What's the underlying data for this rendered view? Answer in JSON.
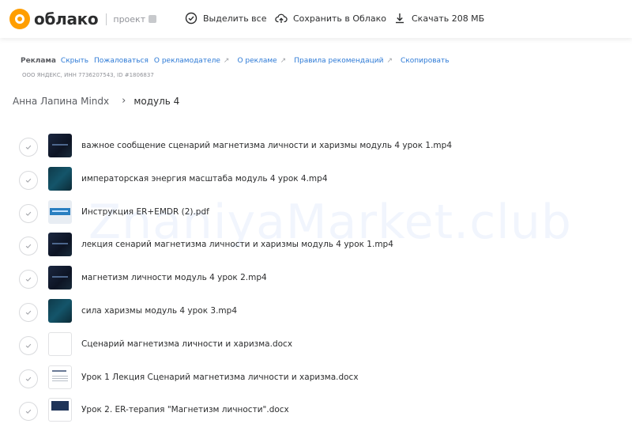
{
  "header": {
    "logo_text": "облако",
    "logo_sub": "проект",
    "select_all": "Выделить все",
    "save_to_cloud": "Сохранить в Облако",
    "download": "Скачать 208 МБ"
  },
  "ad": {
    "label": "Реклама",
    "hide": "Скрыть",
    "complain": "Пожаловаться",
    "about_advertiser": "О рекламодателе",
    "about_ad": "О рекламе",
    "rules": "Правила рекомендаций",
    "copy": "Скопировать",
    "legal": "ООО ЯНДЕКС, ИНН 7736207543, ID #1806837"
  },
  "breadcrumb": {
    "parent": "Анна Лапина Mindx",
    "current": "модуль 4"
  },
  "files": [
    {
      "name": "важное сообщение сценарий магнетизма личности и харизмы модуль 4 урок 1.mp4",
      "thumb": "video"
    },
    {
      "name": "императорская энергия масштаба модуль 4 урок 4.mp4",
      "thumb": "energy"
    },
    {
      "name": "Инструкция ER+EMDR (2).pdf",
      "thumb": "pdf"
    },
    {
      "name": "лекция сенарий магнетизма личности и харизмы модуль 4 урок 1.mp4",
      "thumb": "video"
    },
    {
      "name": "магнетизм личности модуль 4 урок 2.mp4",
      "thumb": "video"
    },
    {
      "name": "сила харизмы модуль 4 урок 3.mp4",
      "thumb": "energy"
    },
    {
      "name": "Сценарий магнетизма личности и харизма.docx",
      "thumb": "doc-blank"
    },
    {
      "name": "Урок 1 Лекция Сценарий магнетизма личности и харизма.docx",
      "thumb": "doc-text"
    },
    {
      "name": "Урок 2. ER-терапия \"Магнетизм личности\".docx",
      "thumb": "doc-dark"
    }
  ],
  "watermark": "ZnaniyaMarket.club",
  "colors": {
    "brand": "#ff9e00",
    "link": "#2d7ad6"
  }
}
